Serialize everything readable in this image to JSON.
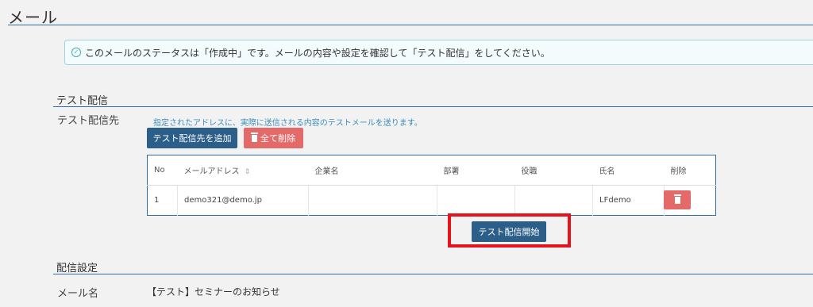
{
  "page": {
    "title": "メール"
  },
  "notice": {
    "text": "このメールのステータスは「作成中」です。メールの内容や設定を確認して「テスト配信」をしてください。"
  },
  "test_delivery": {
    "heading": "テスト配信",
    "field_label": "テスト配信先",
    "help_text": "指定されたアドレスに、実際に送信される内容のテストメールを送ります。",
    "add_button": "テスト配信先を追加",
    "delete_all_button": "全て削除",
    "table": {
      "columns": [
        "No",
        "メールアドレス",
        "企業名",
        "部署",
        "役職",
        "氏名",
        "削除"
      ],
      "rows": [
        {
          "no": "1",
          "email": "demo321@demo.jp",
          "company": "",
          "department": "",
          "position": "",
          "name": "LFdemo"
        }
      ]
    },
    "start_button": "テスト配信開始"
  },
  "delivery_settings": {
    "heading": "配信設定",
    "mail_name_label": "メール名",
    "mail_name_value": "【テスト】セミナーのお知らせ"
  },
  "colors": {
    "primary": "#2b5e88",
    "danger": "#e46a6a",
    "highlight": "#e5131b",
    "rule": "#2f6da3"
  },
  "icons": {
    "notice": "check-circle-icon",
    "sort": "sort-icon",
    "trash": "trash-icon"
  }
}
